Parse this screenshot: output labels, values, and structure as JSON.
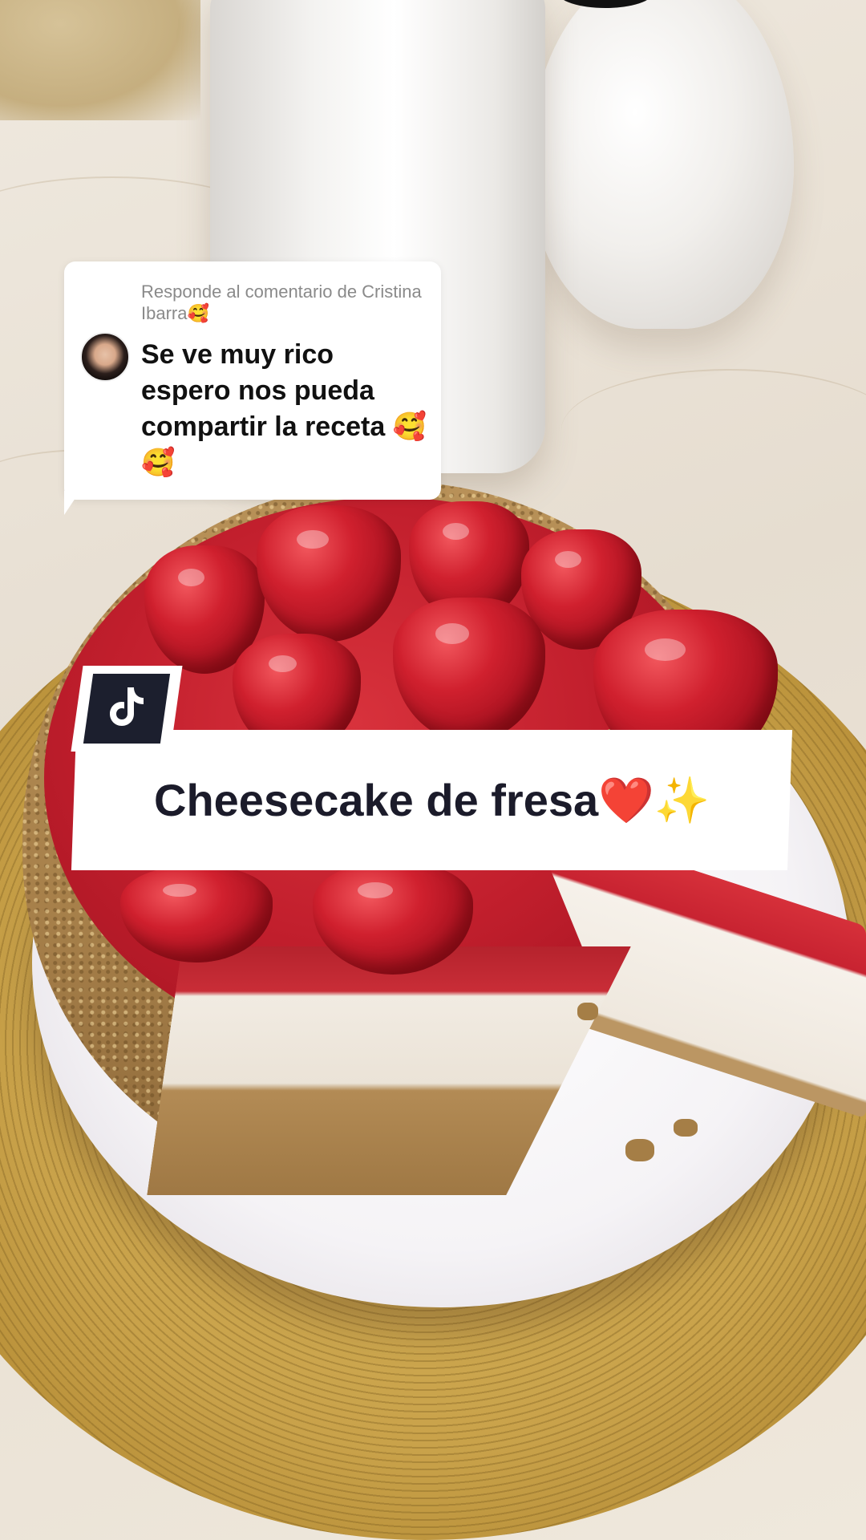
{
  "reply": {
    "header": "Responde al comentario de Cristina Ibarra🥰",
    "comment": "Se ve muy rico espero nos pueda compartir la receta 🥰🥰"
  },
  "title_banner": {
    "text": "Cheesecake de fresa❤️✨"
  },
  "icons": {
    "logo": "tiktok-logo-icon"
  },
  "colors": {
    "banner_background": "#ffffff",
    "logo_tile": "#1c1f2e",
    "title_text": "#1b1b2a",
    "reply_header_text": "#8a8a8a"
  }
}
